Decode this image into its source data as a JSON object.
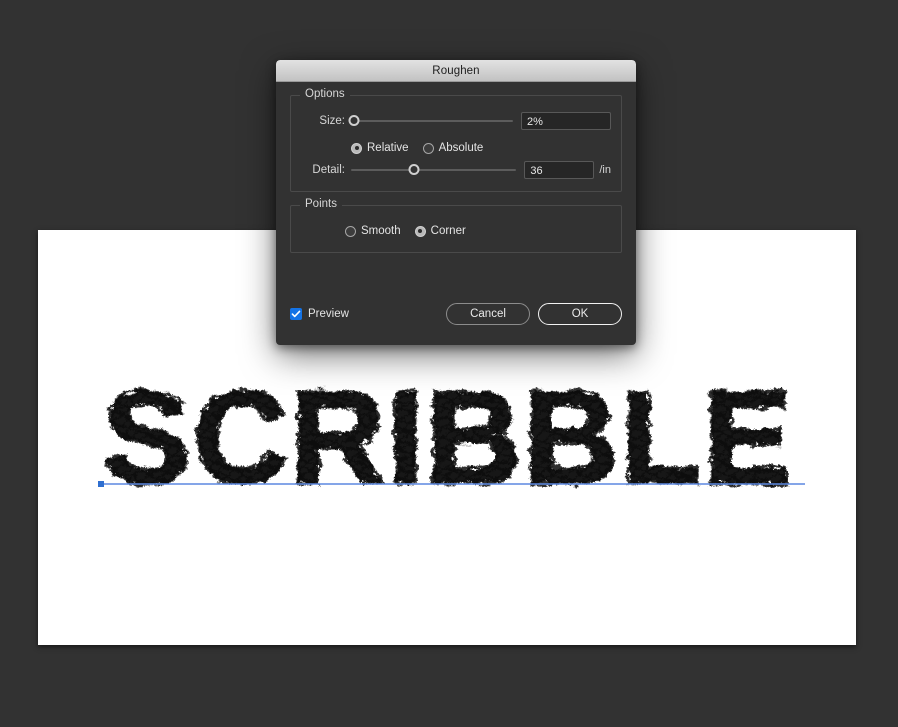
{
  "dialog": {
    "title": "Roughen",
    "options_group": {
      "label": "Options",
      "size": {
        "label": "Size:",
        "value": "2%",
        "slider_percent": 2,
        "mode_relative": "Relative",
        "mode_absolute": "Absolute",
        "selected_mode": "Relative"
      },
      "detail": {
        "label": "Detail:",
        "value": "36",
        "unit": "/in",
        "slider_percent": 38
      }
    },
    "points_group": {
      "label": "Points",
      "smooth": "Smooth",
      "corner": "Corner",
      "selected": "Corner"
    },
    "footer": {
      "preview_label": "Preview",
      "preview_checked": true,
      "cancel_label": "Cancel",
      "ok_label": "OK"
    },
    "colors": {
      "accent_blue": "#1473e6",
      "panel_bg": "#323232",
      "field_bg": "#262626",
      "titlebar_top": "#e2e2e2",
      "titlebar_bottom": "#c2c2c2"
    }
  },
  "canvas": {
    "background": "#ffffff",
    "artwork_text": "SCRIBBLE",
    "artwork_effect": "roughen-scribble",
    "path_color": "#4a7fe0",
    "anchor_color": "#2f6fd0"
  }
}
